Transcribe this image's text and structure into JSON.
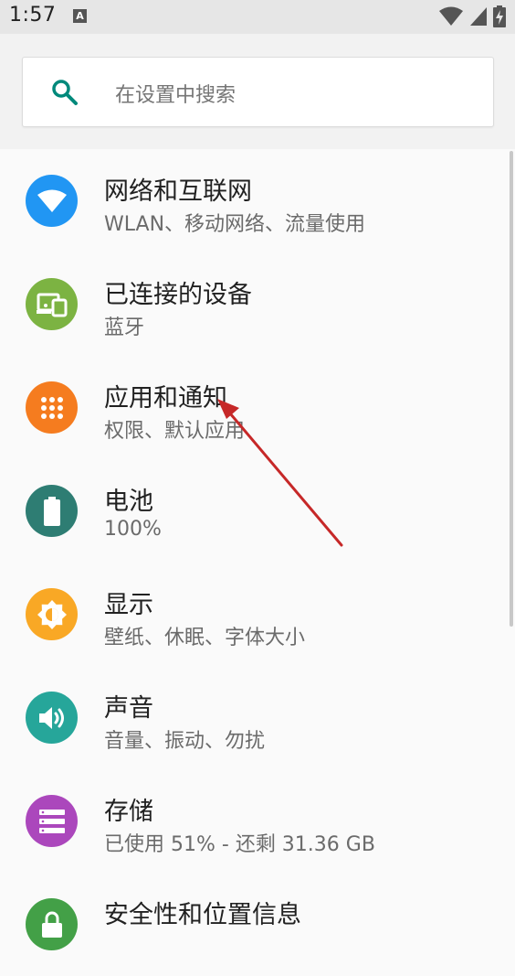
{
  "status_bar": {
    "time": "1:57",
    "notification_letter": "A",
    "wifi_icon": "wifi-icon",
    "cell_icon": "cell-signal-icon",
    "battery_icon": "battery-charging-icon"
  },
  "search": {
    "placeholder": "在设置中搜索",
    "icon": "search-icon",
    "accent": "#00897b"
  },
  "settings": [
    {
      "title": "网络和互联网",
      "subtitle": "WLAN、移动网络、流量使用",
      "icon": "wifi-icon",
      "color": "#2196f3"
    },
    {
      "title": "已连接的设备",
      "subtitle": "蓝牙",
      "icon": "devices-icon",
      "color": "#7cb342"
    },
    {
      "title": "应用和通知",
      "subtitle": "权限、默认应用",
      "icon": "apps-grid-icon",
      "color": "#f57c1f"
    },
    {
      "title": "电池",
      "subtitle": "100%",
      "icon": "battery-icon",
      "color": "#2e7d73"
    },
    {
      "title": "显示",
      "subtitle": "壁纸、休眠、字体大小",
      "icon": "brightness-icon",
      "color": "#f9a825"
    },
    {
      "title": "声音",
      "subtitle": "音量、振动、勿扰",
      "icon": "volume-icon",
      "color": "#26a69a"
    },
    {
      "title": "存储",
      "subtitle": "已使用 51% - 还剩 31.36 GB",
      "icon": "storage-icon",
      "color": "#ab47bc"
    },
    {
      "title": "安全性和位置信息",
      "subtitle": "",
      "icon": "lock-icon",
      "color": "#43a047"
    }
  ],
  "annotation": {
    "color": "#c62828",
    "icon": "red-arrow-annotation"
  }
}
